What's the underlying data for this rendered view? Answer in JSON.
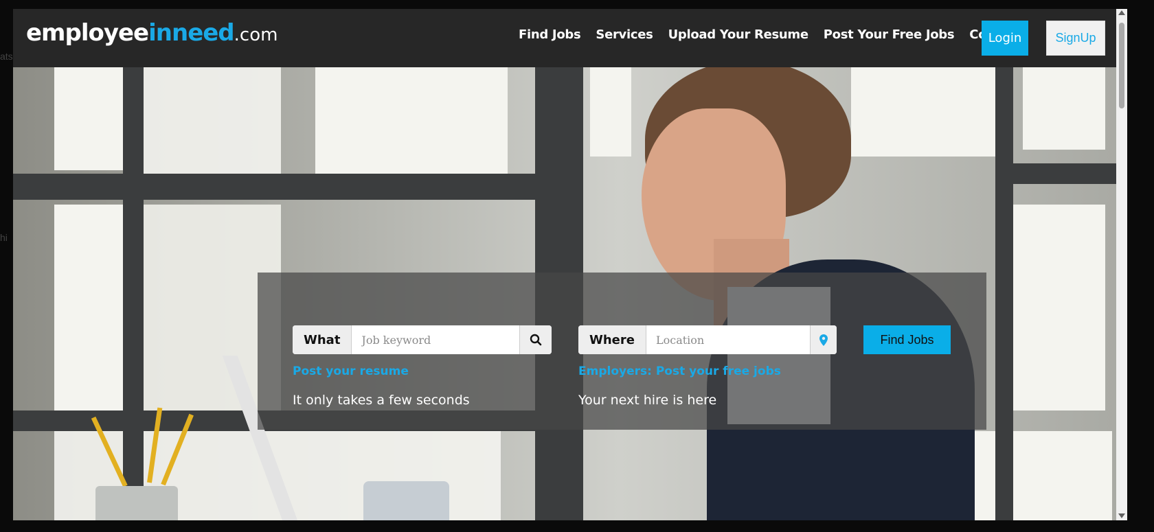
{
  "background": {
    "text_left_top": "ats",
    "text_left_mid": "hi"
  },
  "header": {
    "logo": {
      "part_white": "employee",
      "part_blue": "inneed",
      "part_domain": ".com"
    },
    "nav": [
      "Find Jobs",
      "Services",
      "Upload Your Resume",
      "Post Your Free Jobs",
      "Contact"
    ],
    "login_label": "Login",
    "signup_label": "SignUp"
  },
  "search": {
    "what_label": "What",
    "what_placeholder": "Job keyword",
    "where_label": "Where",
    "where_placeholder": "Location",
    "find_label": "Find Jobs",
    "left_link": "Post your resume",
    "left_note": "It only takes a few seconds",
    "right_link": "Employers: Post your free jobs",
    "right_note": "Your next hire is here"
  },
  "colors": {
    "accent": "#0aaee8",
    "header_bg": "#272727",
    "panel_bg": "rgba(70,70,70,0.72)"
  },
  "icons": {
    "search": "search-icon",
    "location": "map-marker-icon"
  }
}
